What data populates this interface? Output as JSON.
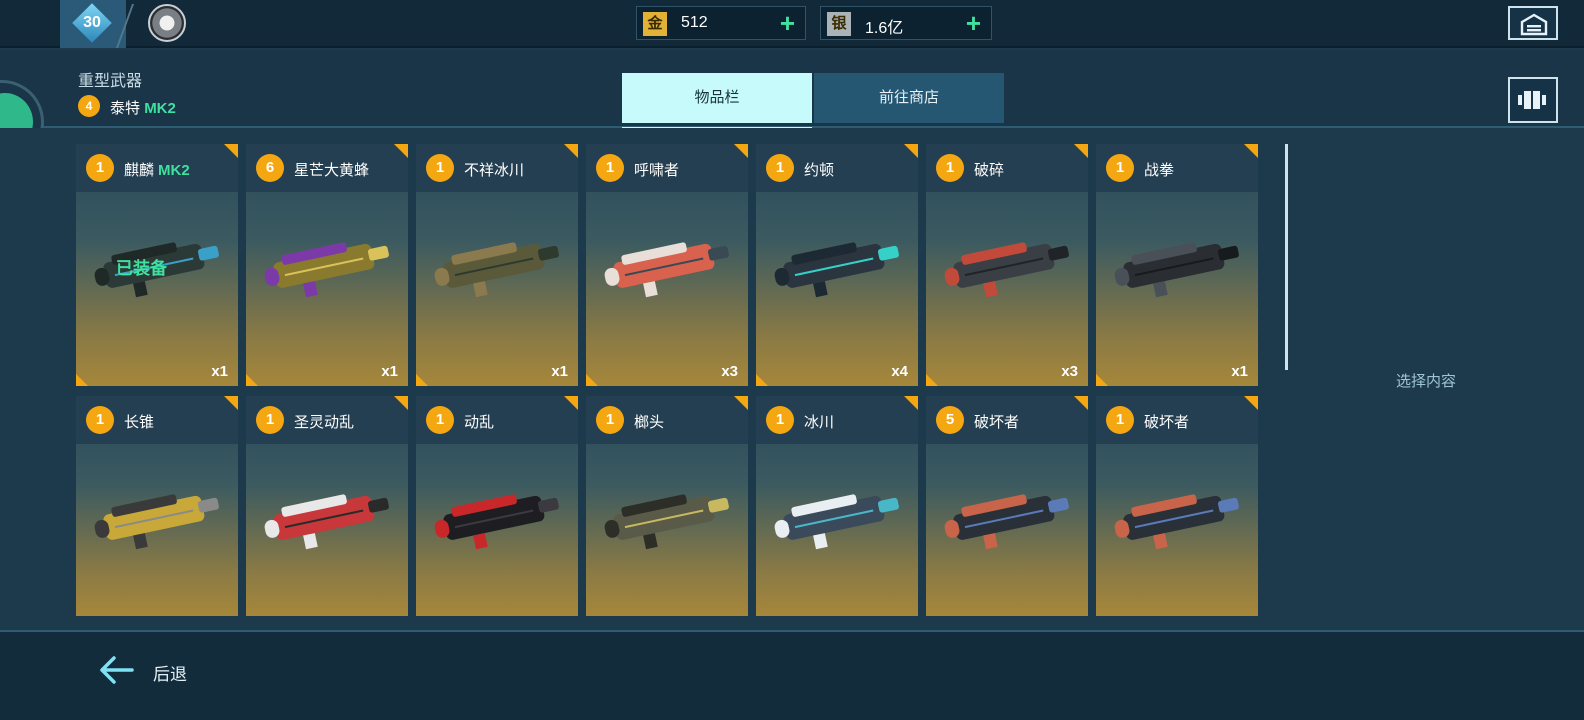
{
  "top": {
    "level": "30",
    "gold": {
      "icon_char": "金",
      "value": "512",
      "plus": "+"
    },
    "silver": {
      "icon_char": "银",
      "value": "1.6亿",
      "plus": "+"
    }
  },
  "header": {
    "category": "重型武器",
    "current_level": "4",
    "current_name": "泰特",
    "current_mk": "MK2"
  },
  "tabs": [
    {
      "label": "物品栏",
      "active": true
    },
    {
      "label": "前往商店",
      "active": false
    }
  ],
  "items": [
    {
      "level": "1",
      "name": "麒麟",
      "mk": "MK2",
      "qty": "x1",
      "equipped": "已装备"
    },
    {
      "level": "6",
      "name": "星芒大黄蜂",
      "mk": "",
      "qty": "x1"
    },
    {
      "level": "1",
      "name": "不祥冰川",
      "mk": "",
      "qty": "x1"
    },
    {
      "level": "1",
      "name": "呼啸者",
      "mk": "",
      "qty": "x3"
    },
    {
      "level": "1",
      "name": "约顿",
      "mk": "",
      "qty": "x4"
    },
    {
      "level": "1",
      "name": "破碎",
      "mk": "",
      "qty": "x3"
    },
    {
      "level": "1",
      "name": "战拳",
      "mk": "",
      "qty": "x1"
    },
    {
      "level": "1",
      "name": "长锥",
      "mk": "",
      "qty": ""
    },
    {
      "level": "1",
      "name": "圣灵动乱",
      "mk": "",
      "qty": ""
    },
    {
      "level": "1",
      "name": "动乱",
      "mk": "",
      "qty": ""
    },
    {
      "level": "1",
      "name": "榔头",
      "mk": "",
      "qty": ""
    },
    {
      "level": "1",
      "name": "冰川",
      "mk": "",
      "qty": ""
    },
    {
      "level": "5",
      "name": "破坏者",
      "mk": "",
      "qty": ""
    },
    {
      "level": "1",
      "name": "破坏者",
      "mk": "",
      "qty": ""
    }
  ],
  "side_panel": {
    "label": "选择内容"
  },
  "footer": {
    "back_label": "后退"
  },
  "colors": {
    "accent_green": "#3fe0a0",
    "badge_orange": "#f5a712",
    "tab_active": "#c7fafa"
  }
}
